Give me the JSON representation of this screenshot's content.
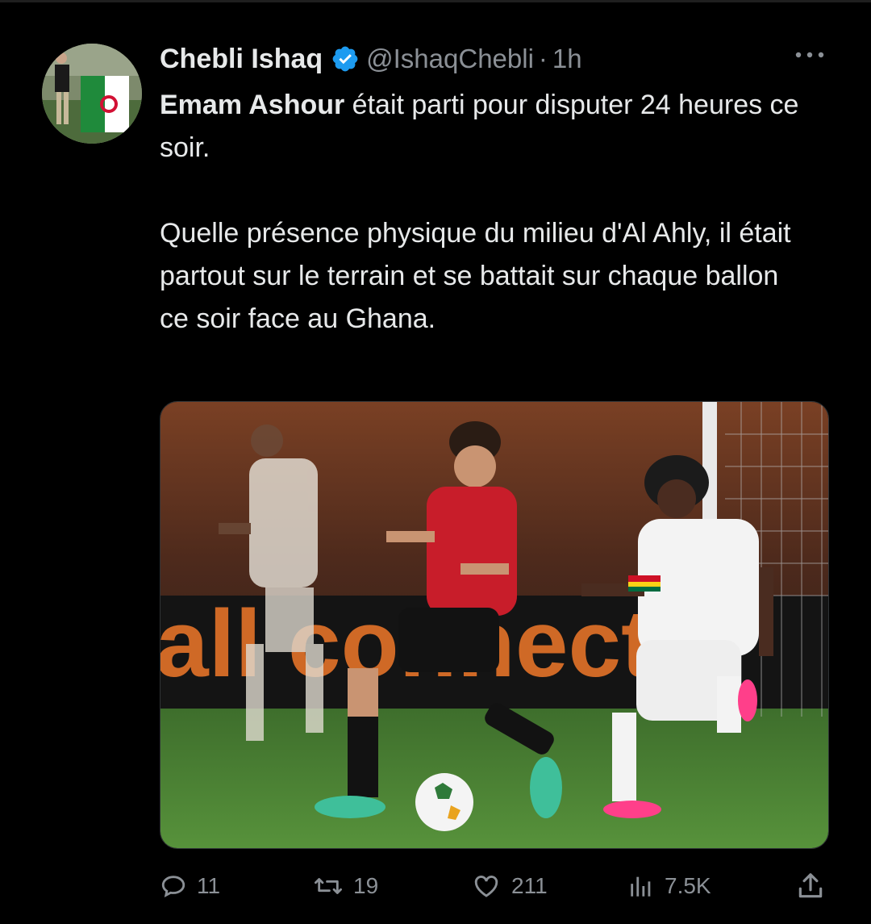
{
  "tweet": {
    "author": {
      "display_name": "Chebli Ishaq",
      "handle": "@IshaqChebli",
      "separator": "·",
      "time": "1h",
      "verified": true
    },
    "text": {
      "mention": "Emam Ashour",
      "line1_rest": " était parti pour disputer 24 heures ce soir.",
      "paragraph2": "Quelle présence physique du milieu d'Al Ahly, il était partout sur le terrain et se battait sur chaque ballon ce soir face au Ghana."
    },
    "media": {
      "type": "photo",
      "board_text": "all connecte"
    },
    "actions": {
      "replies": "11",
      "reposts": "19",
      "likes": "211",
      "views": "7.5K"
    }
  },
  "colors": {
    "background": "#000000",
    "text_primary": "#e7e9ea",
    "text_secondary": "#8b9096",
    "verified_blue": "#1d9bf0"
  },
  "icons": {
    "more": "more-horizontal-icon",
    "reply": "reply-icon",
    "repost": "repost-icon",
    "like": "heart-icon",
    "views": "views-chart-icon",
    "share": "share-icon",
    "verified": "verified-badge-icon"
  }
}
